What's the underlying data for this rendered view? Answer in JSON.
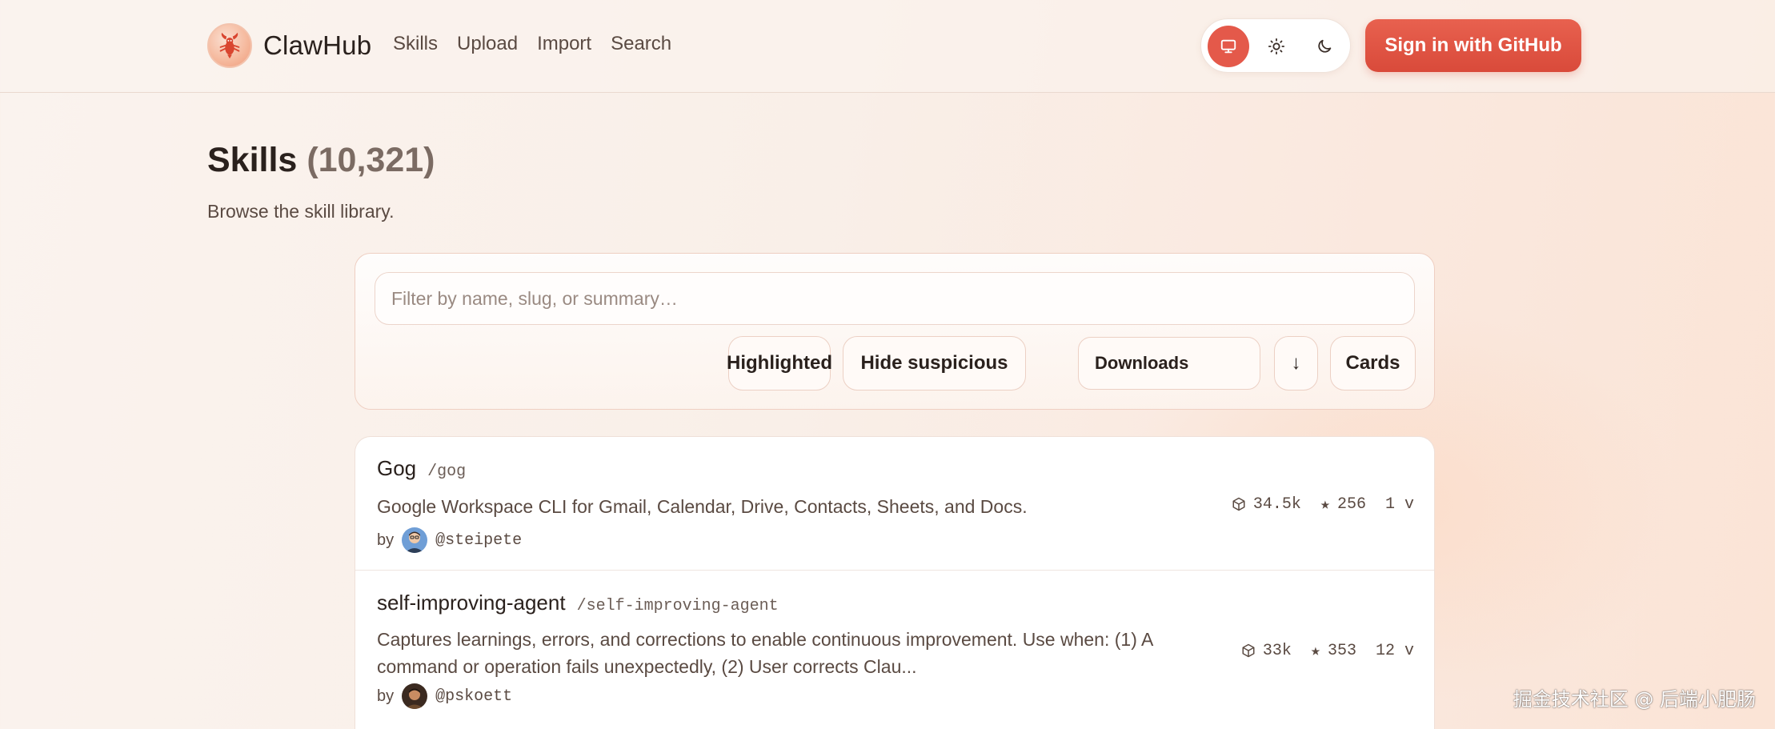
{
  "header": {
    "brand": "ClawHub",
    "nav": [
      "Skills",
      "Upload",
      "Import",
      "Search"
    ],
    "theme_icons": [
      "monitor-icon",
      "sun-icon",
      "moon-icon"
    ],
    "theme_active": "system",
    "signin_label": "Sign in  with GitHub"
  },
  "page": {
    "title": "Skills",
    "count": "(10,321)",
    "subtitle": "Browse the skill library."
  },
  "filters": {
    "search_placeholder": "Filter by name, slug, or summary…",
    "search_value": "",
    "highlighted_label": "Highlighted",
    "hide_suspicious_label": "Hide suspicious",
    "sort_value": "Downloads",
    "direction_label": "↓",
    "view_label": "Cards"
  },
  "skills": [
    {
      "name": "Gog",
      "slug": "/gog",
      "summary": "Google Workspace CLI for Gmail, Calendar, Drive, Contacts, Sheets, and Docs.",
      "by": "by",
      "author": "@steipete",
      "downloads": "34.5k",
      "stars": "256",
      "versions": "1 v"
    },
    {
      "name": "self-improving-agent",
      "slug": "/self-improving-agent",
      "summary": "Captures learnings, errors, and corrections to enable continuous improvement. Use when: (1) A command or operation fails unexpectedly, (2) User corrects Clau...",
      "by": "by",
      "author": "@pskoett",
      "downloads": "33k",
      "stars": "353",
      "versions": "12 v"
    }
  ],
  "colors": {
    "accent": "#e4594a",
    "background": "#faf3ee",
    "text": "#2a211d"
  },
  "watermark": "掘金技术社区 @ 后端小肥肠"
}
